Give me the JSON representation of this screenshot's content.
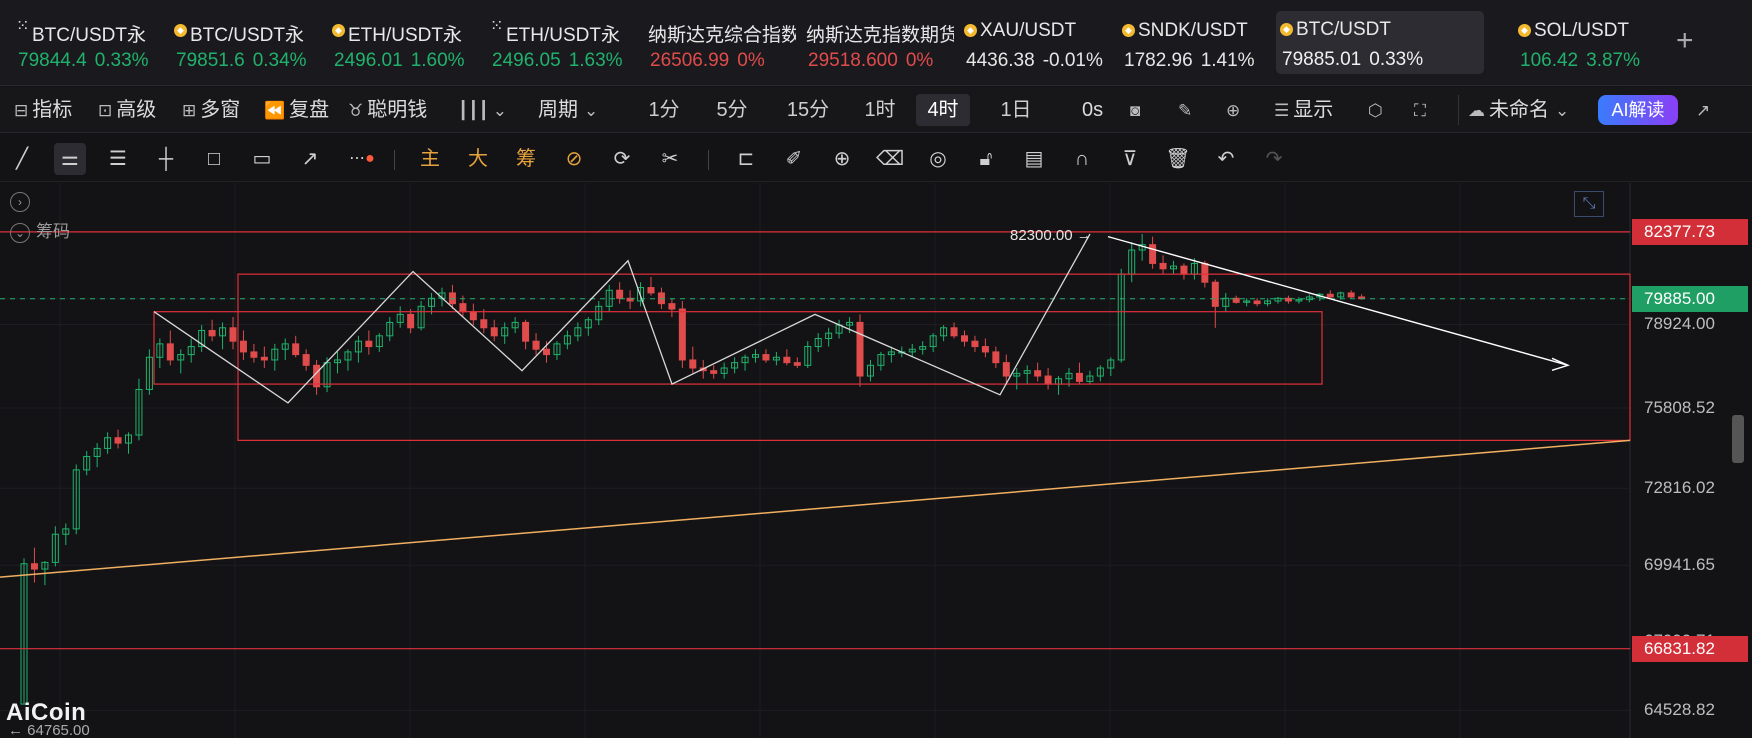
{
  "tickers": [
    {
      "name": "BTC/USDT永",
      "price": "79844.4",
      "change": "0.33%",
      "color": "#20b26c",
      "icon": "x-icon",
      "left": 0
    },
    {
      "name": "BTC/USDT永",
      "price": "79851.6",
      "change": "0.34%",
      "color": "#20b26c",
      "icon": "coin-icon",
      "left": 158
    },
    {
      "name": "ETH/USDT永",
      "price": "2496.01",
      "change": "1.60%",
      "color": "#20b26c",
      "icon": "coin-icon",
      "left": 316
    },
    {
      "name": "ETH/USDT永",
      "price": "2496.05",
      "change": "1.63%",
      "color": "#20b26c",
      "icon": "x-icon",
      "left": 474
    },
    {
      "name": "纳斯达克综合指数",
      "price": "26506.99",
      "change": "0%",
      "color": "#e04b4b",
      "icon": "none",
      "left": 632
    },
    {
      "name": "纳斯达克指数期货",
      "price": "29518.600",
      "change": "0%",
      "color": "#e04b4b",
      "icon": "none",
      "left": 790
    },
    {
      "name": "XAU/USDT",
      "price": "4436.38",
      "change": "-0.01%",
      "color": "#e6e6e6",
      "icon": "coin-icon",
      "left": 948
    },
    {
      "name": "SNDK/USDT",
      "price": "1782.96",
      "change": "1.41%",
      "color": "#e6e6e6",
      "icon": "coin-icon",
      "left": 1106
    },
    {
      "name": "BTC/USDT",
      "price": "79885.01",
      "change": "0.33%",
      "color": "#f0f0f0",
      "icon": "coin-icon",
      "left": 1264,
      "active": true
    },
    {
      "name": "SOL/USDT",
      "price": "106.42",
      "change": "3.87%",
      "color": "#20b26c",
      "icon": "coin-icon",
      "left": 1502
    }
  ],
  "add_tab": "+",
  "toolbar": {
    "indicators": "指标",
    "advanced": "高级",
    "multi_window": "多窗",
    "replay": "复盘",
    "smart_money": "聪明钱",
    "period": "周期",
    "timeframes": [
      "1分",
      "5分",
      "15分",
      "1时",
      "4时",
      "1日"
    ],
    "active_timeframe": "4时",
    "countdown": "0s",
    "display": "显示",
    "layout_name": "未命名",
    "ai_button": "AI解读"
  },
  "drawing_tools": {
    "main_label": "主",
    "big_label": "大",
    "chips_label": "筹"
  },
  "chart": {
    "overlay_label": "筹码",
    "logo": "AiCoin",
    "annotation": "82300.00 →",
    "partial_low_label": "64765.00",
    "price_axis": [
      "82377.73",
      "79885.00",
      "78924.00",
      "75808.52",
      "72816.02",
      "69941.65",
      "67099.71",
      "66831.82",
      "64528.82"
    ],
    "current_price": "79885.00",
    "resistance_price": "82377.73",
    "support_price": "66831.82",
    "colors": {
      "up": "#20b26c",
      "down": "#e04b4b",
      "box": "#e0303a",
      "trendline": "#f0b060",
      "zigzag": "#d8d8d8",
      "tag_red": "#d22f38",
      "tag_green": "#1f9f63"
    }
  },
  "chart_data": {
    "type": "candlestick",
    "symbol": "BTC/USDT",
    "timeframe": "4时",
    "ylim": [
      63500,
      84200
    ],
    "yticks": [
      82377.73,
      79885.0,
      78924.0,
      75808.52,
      72816.02,
      69941.65,
      66831.82,
      64528.82
    ],
    "candles": [
      [
        64765,
        70200,
        64765,
        70000
      ],
      [
        70000,
        70600,
        69300,
        69800
      ],
      [
        69800,
        70100,
        69200,
        70050
      ],
      [
        70050,
        71400,
        69900,
        71100
      ],
      [
        71100,
        71500,
        70700,
        71300
      ],
      [
        71300,
        73700,
        71100,
        73500
      ],
      [
        73500,
        74200,
        73300,
        74000
      ],
      [
        74000,
        74500,
        73600,
        74300
      ],
      [
        74300,
        74900,
        74100,
        74700
      ],
      [
        74700,
        75000,
        74300,
        74500
      ],
      [
        74500,
        74900,
        74100,
        74800
      ],
      [
        74800,
        76900,
        74600,
        76500
      ],
      [
        76500,
        78000,
        76300,
        77700
      ],
      [
        77700,
        78400,
        77300,
        78200
      ],
      [
        78200,
        78700,
        77400,
        77600
      ],
      [
        77600,
        78000,
        77100,
        77800
      ],
      [
        77800,
        78400,
        77500,
        78100
      ],
      [
        78100,
        78900,
        77900,
        78700
      ],
      [
        78700,
        79100,
        78300,
        78500
      ],
      [
        78500,
        79000,
        78000,
        78800
      ],
      [
        78800,
        79200,
        78000,
        78300
      ],
      [
        78300,
        78700,
        77600,
        77900
      ],
      [
        77900,
        78200,
        77500,
        77700
      ],
      [
        77700,
        78100,
        77300,
        77600
      ],
      [
        77600,
        78200,
        77200,
        78000
      ],
      [
        78000,
        78400,
        77600,
        78200
      ],
      [
        78200,
        78500,
        77700,
        77800
      ],
      [
        77800,
        78000,
        77200,
        77400
      ],
      [
        77400,
        77600,
        76300,
        76600
      ],
      [
        76600,
        77700,
        76400,
        77500
      ],
      [
        77500,
        77900,
        77100,
        77600
      ],
      [
        77600,
        78000,
        77200,
        77900
      ],
      [
        77900,
        78500,
        77500,
        78300
      ],
      [
        78300,
        78700,
        77800,
        78100
      ],
      [
        78100,
        78600,
        77900,
        78500
      ],
      [
        78500,
        79200,
        78300,
        79000
      ],
      [
        79000,
        79600,
        78800,
        79300
      ],
      [
        79300,
        79500,
        78600,
        78800
      ],
      [
        78800,
        79800,
        78700,
        79600
      ],
      [
        79600,
        80100,
        79300,
        79900
      ],
      [
        79900,
        80300,
        79600,
        80100
      ],
      [
        80100,
        80400,
        79500,
        79700
      ],
      [
        79700,
        80000,
        79200,
        79400
      ],
      [
        79400,
        79700,
        78900,
        79100
      ],
      [
        79100,
        79500,
        78600,
        78800
      ],
      [
        78800,
        79100,
        78300,
        78500
      ],
      [
        78500,
        79000,
        78200,
        78800
      ],
      [
        78800,
        79200,
        78600,
        79000
      ],
      [
        79000,
        79100,
        78000,
        78300
      ],
      [
        78300,
        78600,
        77800,
        78000
      ],
      [
        78000,
        78300,
        77500,
        77800
      ],
      [
        77800,
        78300,
        77600,
        78200
      ],
      [
        78200,
        78700,
        78000,
        78500
      ],
      [
        78500,
        79000,
        78300,
        78800
      ],
      [
        78800,
        79200,
        78500,
        79100
      ],
      [
        79100,
        79800,
        78900,
        79600
      ],
      [
        79600,
        80400,
        79400,
        80200
      ],
      [
        80200,
        80500,
        79700,
        79900
      ],
      [
        79900,
        80200,
        79500,
        79800
      ],
      [
        79800,
        80500,
        79600,
        80300
      ],
      [
        80300,
        80700,
        80000,
        80100
      ],
      [
        80100,
        80300,
        79500,
        79700
      ],
      [
        79700,
        79900,
        79200,
        79500
      ],
      [
        79500,
        79800,
        77300,
        77600
      ],
      [
        77600,
        78100,
        77100,
        77300
      ],
      [
        77300,
        77600,
        76900,
        77200
      ],
      [
        77200,
        77400,
        76900,
        77100
      ],
      [
        77100,
        77500,
        76900,
        77300
      ],
      [
        77300,
        77700,
        77100,
        77500
      ],
      [
        77500,
        77800,
        77200,
        77700
      ],
      [
        77700,
        78000,
        77500,
        77800
      ],
      [
        77800,
        78000,
        77500,
        77600
      ],
      [
        77600,
        77900,
        77400,
        77700
      ],
      [
        77700,
        78000,
        77400,
        77500
      ],
      [
        77500,
        77700,
        77300,
        77400
      ],
      [
        77400,
        78300,
        77300,
        78100
      ],
      [
        78100,
        78600,
        77900,
        78400
      ],
      [
        78400,
        78800,
        78100,
        78600
      ],
      [
        78600,
        79100,
        78400,
        78900
      ],
      [
        78900,
        79200,
        78600,
        79000
      ],
      [
        79000,
        79300,
        76600,
        77000
      ],
      [
        77000,
        77600,
        76800,
        77400
      ],
      [
        77400,
        77900,
        77200,
        77800
      ],
      [
        77800,
        78100,
        77500,
        77900
      ],
      [
        77900,
        78100,
        77700,
        77900
      ],
      [
        77900,
        78200,
        77700,
        78000
      ],
      [
        78000,
        78300,
        77800,
        78100
      ],
      [
        78100,
        78600,
        77900,
        78500
      ],
      [
        78500,
        78900,
        78300,
        78800
      ],
      [
        78800,
        79000,
        78400,
        78500
      ],
      [
        78500,
        78700,
        78100,
        78300
      ],
      [
        78300,
        78500,
        77900,
        78100
      ],
      [
        78100,
        78400,
        77700,
        77900
      ],
      [
        77900,
        78100,
        77300,
        77500
      ],
      [
        77500,
        77800,
        76700,
        77000
      ],
      [
        77000,
        77300,
        76500,
        77100
      ],
      [
        77100,
        77400,
        76700,
        77200
      ],
      [
        77200,
        77500,
        76800,
        77000
      ],
      [
        77000,
        77300,
        76500,
        76700
      ],
      [
        76700,
        77000,
        76300,
        76900
      ],
      [
        76900,
        77300,
        76600,
        77100
      ],
      [
        77100,
        77500,
        76700,
        76800
      ],
      [
        76800,
        77200,
        76700,
        77000
      ],
      [
        77000,
        77400,
        76800,
        77300
      ],
      [
        77300,
        77700,
        77000,
        77600
      ],
      [
        77600,
        81000,
        77500,
        80800
      ],
      [
        80800,
        82000,
        80500,
        81700
      ],
      [
        81700,
        82300,
        81300,
        81900
      ],
      [
        81900,
        82200,
        81000,
        81200
      ],
      [
        81200,
        81500,
        80800,
        81000
      ],
      [
        81000,
        81300,
        80800,
        81100
      ],
      [
        81100,
        81200,
        80600,
        80800
      ],
      [
        80800,
        81400,
        80600,
        81200
      ],
      [
        81200,
        81300,
        80300,
        80500
      ],
      [
        80500,
        80600,
        78800,
        79600
      ],
      [
        79600,
        80100,
        79400,
        79900
      ],
      [
        79900,
        80000,
        79700,
        79750
      ],
      [
        79750,
        79900,
        79600,
        79800
      ],
      [
        79800,
        79900,
        79600,
        79700
      ],
      [
        79700,
        79900,
        79600,
        79800
      ],
      [
        79800,
        79950,
        79700,
        79900
      ],
      [
        79900,
        80000,
        79700,
        79800
      ],
      [
        79800,
        79950,
        79700,
        79850
      ],
      [
        79850,
        80050,
        79750,
        79950
      ],
      [
        79950,
        80100,
        79800,
        80050
      ],
      [
        80050,
        80200,
        79900,
        79950
      ],
      [
        79950,
        80150,
        79850,
        80100
      ],
      [
        80100,
        80200,
        79900,
        79950
      ],
      [
        79950,
        80050,
        79850,
        79885
      ]
    ],
    "annotations": {
      "high_marker": 82300.0,
      "last_price": 79885.0
    }
  }
}
